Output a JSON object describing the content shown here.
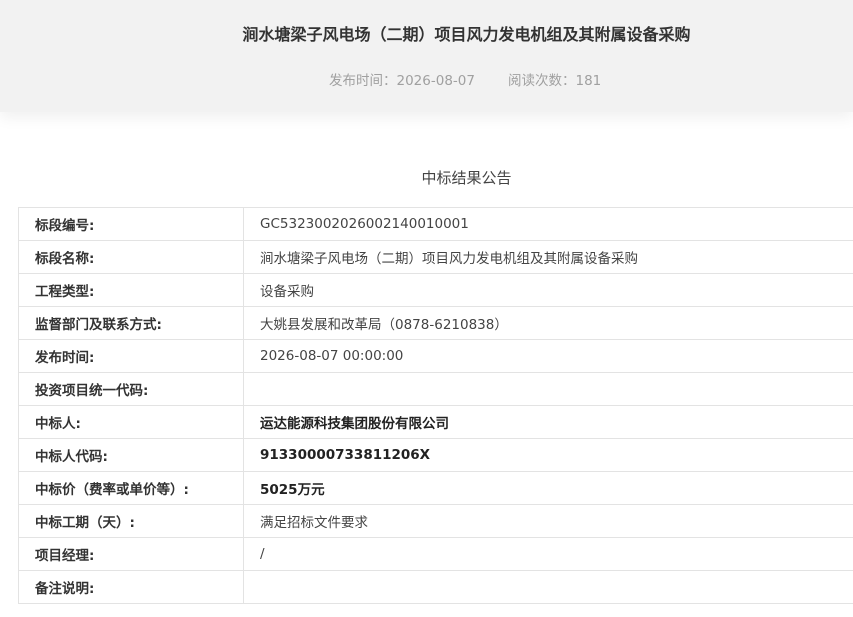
{
  "header": {
    "title": "涧水塘梁子风电场（二期）项目风力发电机组及其附属设备采购",
    "publish_date": "发布时间：2026-08-07",
    "read_count": "阅读次数：181"
  },
  "notice_title": "中标结果公告",
  "rows": [
    {
      "label": "标段编号:",
      "value": "GC5323002026002140010001"
    },
    {
      "label": "标段名称:",
      "value": "涧水塘梁子风电场（二期）项目风力发电机组及其附属设备采购"
    },
    {
      "label": "工程类型:",
      "value": "设备采购"
    },
    {
      "label": "监督部门及联系方式:",
      "value": "大姚县发展和改革局（0878-6210838）"
    },
    {
      "label": "发布时间:",
      "value": "2026-08-07 00:00:00"
    },
    {
      "label": "投资项目统一代码:",
      "value": ""
    },
    {
      "label": "中标人:",
      "value": "运达能源科技集团股份有限公司"
    },
    {
      "label": "中标人代码:",
      "value": "91330000733811206X"
    },
    {
      "label": "中标价（费率或单价等）:",
      "value": "5025万元"
    },
    {
      "label": "中标工期（天）:",
      "value": "满足招标文件要求"
    },
    {
      "label": "项目经理:",
      "value": "/"
    },
    {
      "label": "备注说明:",
      "value": ""
    }
  ]
}
